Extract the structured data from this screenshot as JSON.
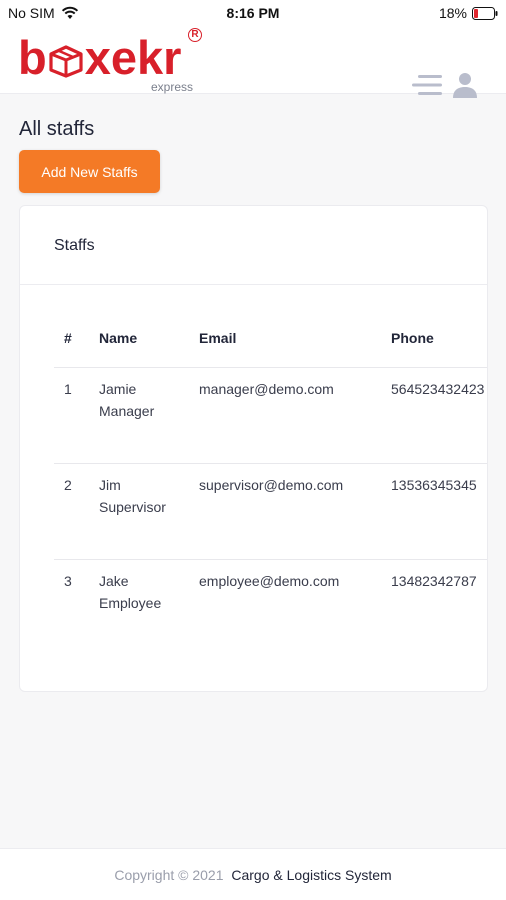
{
  "status_bar": {
    "carrier": "No SIM",
    "time": "8:16 PM",
    "battery": "18%"
  },
  "header": {
    "logo_text_left": "b",
    "logo_text_right": "xekr",
    "logo_tagline": "express",
    "logo_reg": "R",
    "menu_icon": "menu-lines-icon",
    "user_icon": "user-icon"
  },
  "page": {
    "title": "All staffs",
    "add_button_label": "Add New Staffs"
  },
  "card": {
    "title": "Staffs"
  },
  "table": {
    "headers": [
      "#",
      "Name",
      "Email",
      "Phone"
    ],
    "rows": [
      {
        "num": "1",
        "name": "Jamie Manager",
        "email": "manager@demo.com",
        "phone": "564523432423"
      },
      {
        "num": "2",
        "name": "Jim Supervisor",
        "email": "supervisor@demo.com",
        "phone": "13536345345"
      },
      {
        "num": "3",
        "name": "Jake Employee",
        "email": "employee@demo.com",
        "phone": "13482342787"
      }
    ]
  },
  "footer": {
    "copyright": "Copyright © 2021",
    "brand": "Cargo & Logistics System"
  },
  "colors": {
    "brand_red": "#d8202a",
    "accent_orange": "#f47a26",
    "text_dark": "#222639"
  }
}
